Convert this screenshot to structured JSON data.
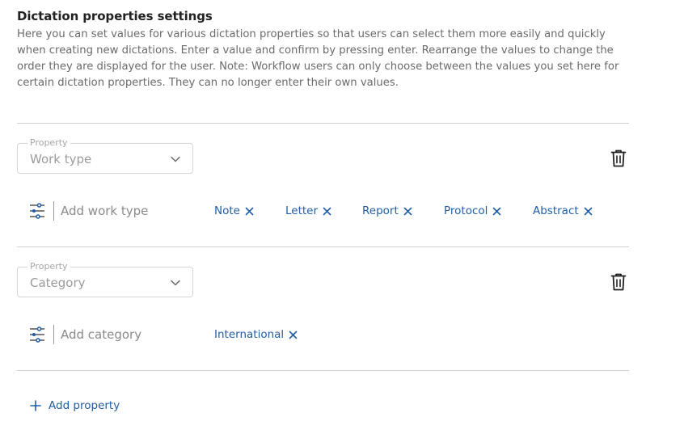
{
  "section": {
    "title": "Dictation properties settings",
    "description": "Here you can set values for various dictation properties so that users can select them more easily and quickly when creating new dictations. Enter a value and confirm by pressing enter. Rearrange the values to change the order they are displayed for the user. Note: Workflow users can only choose between the values you set here for certain dictation properties. They can no longer enter their own values."
  },
  "properties": [
    {
      "legend": "Property",
      "selected": "Work type",
      "add_placeholder": "Add work type",
      "values": [
        "Note",
        "Letter",
        "Report",
        "Protocol",
        "Abstract"
      ]
    },
    {
      "legend": "Property",
      "selected": "Category",
      "add_placeholder": "Add category",
      "values": [
        "International"
      ]
    }
  ],
  "add_property_label": "Add property",
  "icons": {
    "dropdown": "chevron-down-icon",
    "delete": "trash-icon",
    "reorder": "sliders-icon",
    "remove_value": "close-icon",
    "add": "plus-icon"
  },
  "colors": {
    "accent": "#1f5ea8",
    "muted_text": "#6b6b6b",
    "border": "#d6d6d6",
    "divider": "#cfcfcf"
  }
}
